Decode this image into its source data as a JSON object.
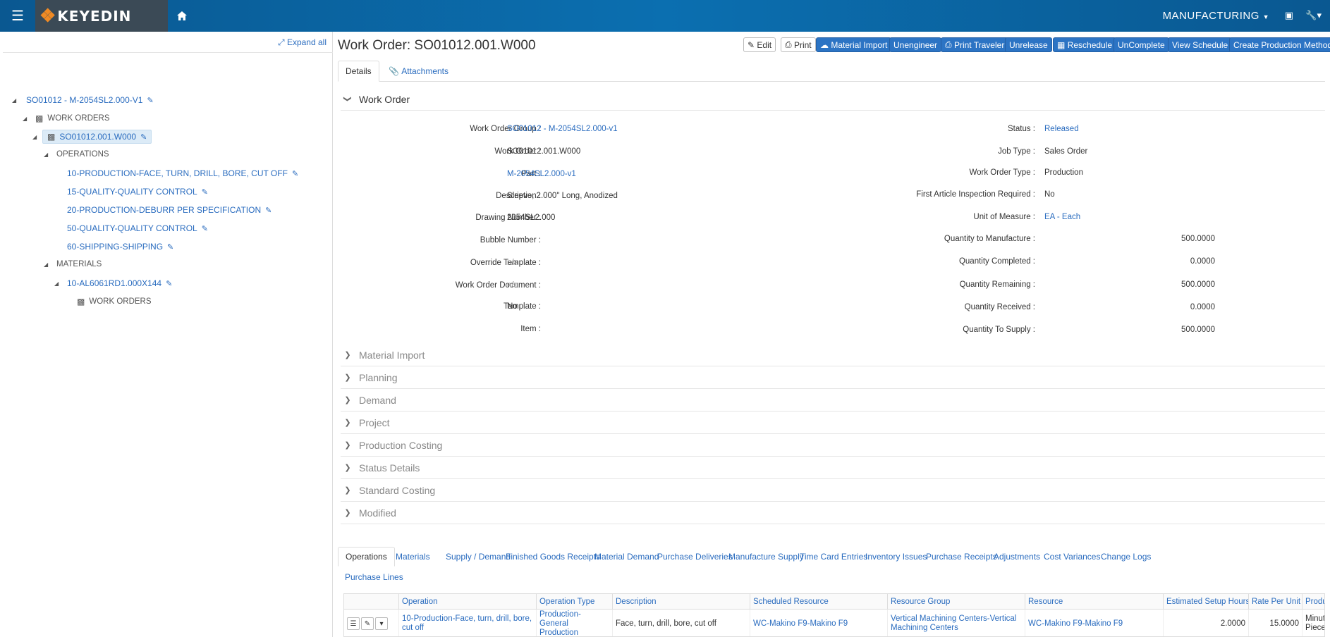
{
  "app": {
    "logo_text": "KEYEDIN",
    "module": "MANUFACTURING"
  },
  "tree": {
    "expand_all": "Expand all",
    "nodes": [
      {
        "label": "SO01012 - M-2054SL2.000-V1"
      },
      {
        "label": "WORK ORDERS"
      },
      {
        "label": "SO01012.001.W000"
      },
      {
        "label": "OPERATIONS"
      },
      {
        "label": "10-PRODUCTION-FACE, TURN, DRILL, BORE, CUT OFF"
      },
      {
        "label": "15-QUALITY-QUALITY CONTROL"
      },
      {
        "label": "20-PRODUCTION-DEBURR PER SPECIFICATION"
      },
      {
        "label": "50-QUALITY-QUALITY CONTROL"
      },
      {
        "label": "60-SHIPPING-SHIPPING"
      },
      {
        "label": "MATERIALS"
      },
      {
        "label": "10-AL6061RD1.000X144"
      },
      {
        "label": "WORK ORDERS"
      }
    ]
  },
  "header": {
    "title_prefix": "Work Order:",
    "title_value": "SO01012.001.W000",
    "buttons": [
      "Edit",
      "Print",
      "Material Import",
      "Unengineer",
      "Print Traveler",
      "Unrelease",
      "Reschedule",
      "UnComplete",
      "View Schedule",
      "Create Production Method"
    ]
  },
  "tabs": [
    "Details",
    "Attachments"
  ],
  "work_order_section": "Work Order",
  "fields_left": [
    {
      "label": "Work Order Group :",
      "value": "SO01012 - M-2054SL2.000-v1"
    },
    {
      "label": "Work Order :",
      "value": "SO01012.001.W000"
    },
    {
      "label": "Part :",
      "value": "M-2054SL2.000-v1"
    },
    {
      "label": "Description :",
      "value": "Sleeve, 2.000\" Long, Anodized"
    },
    {
      "label": "Drawing Number :",
      "value": "2054SL2.000"
    },
    {
      "label": "Bubble Number :",
      "value": ""
    },
    {
      "label": "Override Template :",
      "value": "n/a"
    },
    {
      "label": "Work Order Document :",
      "value": "n/a"
    },
    {
      "label": "Template :",
      "value": "No"
    },
    {
      "label": "Item :",
      "value": ""
    }
  ],
  "fields_right": [
    {
      "label": "Status :",
      "value": "Released"
    },
    {
      "label": "Job Type :",
      "value": "Sales Order"
    },
    {
      "label": "Work Order Type :",
      "value": "Production"
    },
    {
      "label": "First Article Inspection Required :",
      "value": "No"
    },
    {
      "label": "Unit of Measure :",
      "value": "EA - Each"
    },
    {
      "label": "Quantity to Manufacture :",
      "value": "500.0000"
    },
    {
      "label": "Quantity Completed :",
      "value": "0.0000"
    },
    {
      "label": "Quantity Remaining :",
      "value": "500.0000"
    },
    {
      "label": "Quantity Received :",
      "value": "0.0000"
    },
    {
      "label": "Quantity To Supply :",
      "value": "500.0000"
    }
  ],
  "collapsed_sections": [
    "Material Import",
    "Planning",
    "Demand",
    "Project",
    "Production Costing",
    "Status Details",
    "Standard Costing",
    "Modified"
  ],
  "bottom_tabs": [
    "Operations",
    "Materials",
    "Supply / Demand",
    "Finished Goods Receipts",
    "Material Demand",
    "Purchase Deliveries",
    "Manufacture Supply",
    "Time Card Entries",
    "Inventory Issues",
    "Purchase Receipts",
    "Adjustments",
    "Cost Variances",
    "Change Logs",
    "Purchase Lines"
  ],
  "grid": {
    "columns": [
      "Operation",
      "Operation Type",
      "Description",
      "Scheduled Resource",
      "Resource Group",
      "Resource",
      "Estimated Setup Hours",
      "Rate Per Unit",
      "Produ"
    ],
    "row": {
      "operation": "10-Production-Face, turn, drill, bore, cut off",
      "operation_type": "Production-General Production",
      "description": "Face, turn, drill, bore, cut off",
      "scheduled_resource": "WC-Makino F9-Makino F9",
      "resource_group": "Vertical Machining Centers-Vertical Machining Centers",
      "resource": "WC-Makino F9-Makino F9",
      "setup_hours": "2.0000",
      "rate_per_unit": "15.0000",
      "produ": "Minut Piece"
    }
  }
}
